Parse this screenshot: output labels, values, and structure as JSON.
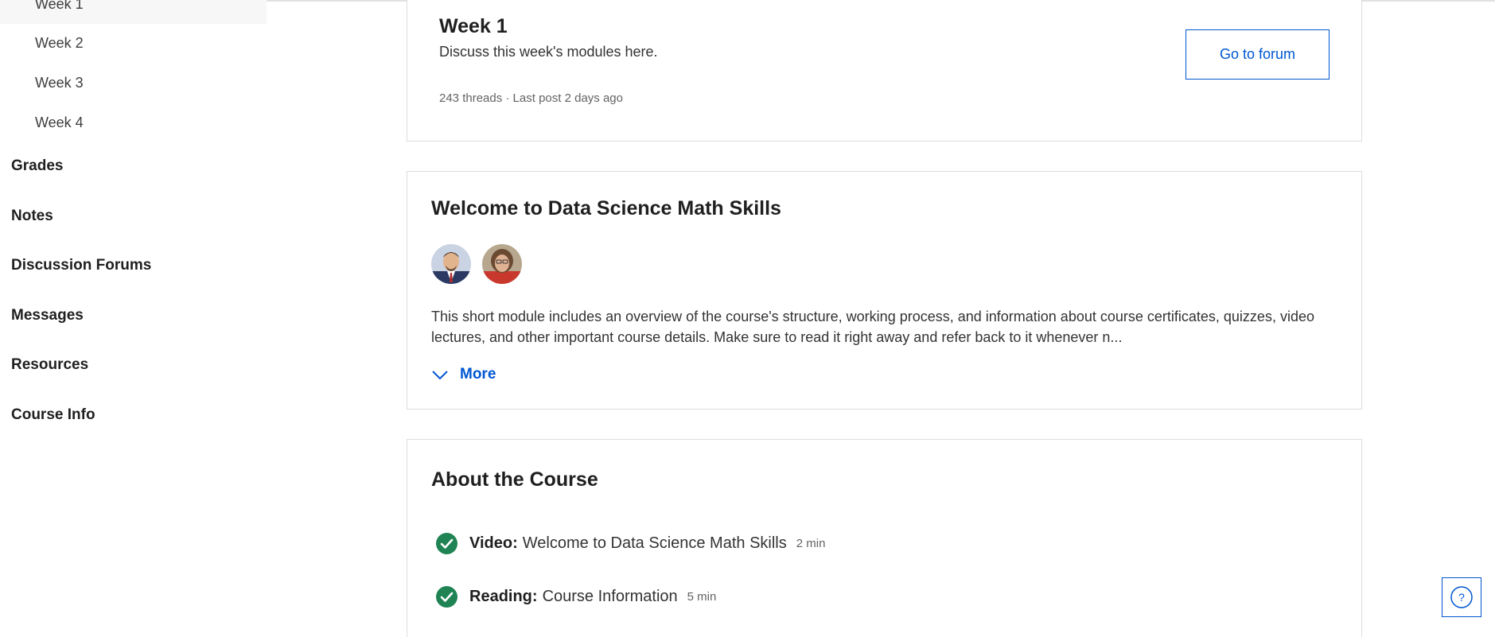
{
  "sidebar": {
    "weeks": [
      "Week 1",
      "Week 2",
      "Week 3",
      "Week 4"
    ],
    "nav": [
      "Grades",
      "Notes",
      "Discussion Forums",
      "Messages",
      "Resources",
      "Course Info"
    ]
  },
  "forum": {
    "title": "Week 1",
    "description": "Discuss this week's modules here.",
    "meta": "243 threads · Last post 2 days ago",
    "button_label": "Go to forum"
  },
  "welcome": {
    "title": "Welcome to Data Science Math Skills",
    "description": "This short module includes an overview of the course's structure, working process, and information about course certificates, quizzes, video lectures, and other important course details. Make sure to read it right away and refer back to it whenever n...",
    "more_label": "More"
  },
  "about": {
    "title": "About the Course",
    "items": [
      {
        "type": "Video:",
        "name": "Welcome to Data Science Math Skills",
        "duration": "2 min",
        "icon": "check-circle-icon"
      },
      {
        "type": "Reading:",
        "name": "Course Information",
        "duration": "5 min",
        "icon": "check-circle-icon"
      }
    ]
  },
  "colors": {
    "accent": "#0056d2",
    "success": "#1f8354",
    "border": "#dedede"
  },
  "help": {
    "icon": "help-icon",
    "label": "?"
  }
}
